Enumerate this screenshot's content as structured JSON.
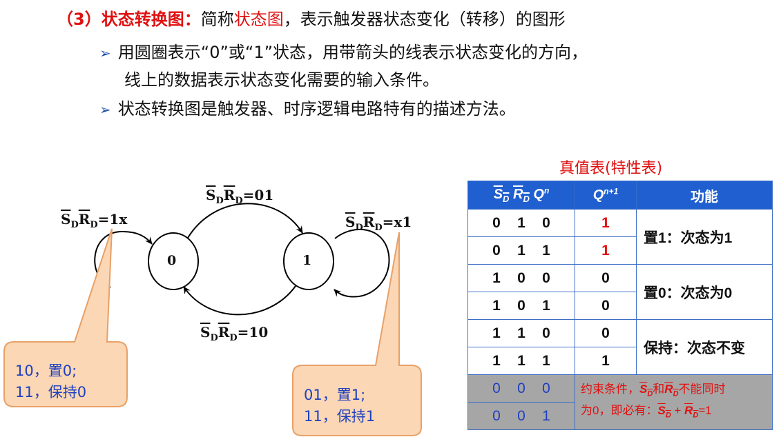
{
  "header": {
    "heading": "（3）状态转换图：",
    "intro_a": "简称",
    "intro_red": "状态图",
    "intro_b": "，表示触发器状态变化（转移）的图形"
  },
  "bullets": {
    "b1_line1": "用圆圈表示“0”或“1”状态，用带箭头的线表示状态变化的方向，",
    "b1_line2": "线上的数据表示状态变化需要的输入条件。",
    "b2": "状态转换图是触发器、时序逻辑电路特有的描述方法。"
  },
  "diagram": {
    "state0": "0",
    "state1": "1",
    "top_label_value": "=01",
    "bottom_label_value": "=10",
    "left_label_value": "=1x",
    "right_label_value": "=x1",
    "callout_left": [
      "10，置0;",
      "11，保持0"
    ],
    "callout_right": [
      "01，置1;",
      "11，保持1"
    ]
  },
  "truth_table": {
    "title": "真值表(特性表)",
    "headers": [
      "S_D R_D Q^n",
      "Q^{n+1}",
      "功能"
    ],
    "rows": [
      {
        "inputs": [
          "0",
          "1",
          "0"
        ],
        "q": "1",
        "func": "置1：次态为1"
      },
      {
        "inputs": [
          "0",
          "1",
          "1"
        ],
        "q": "1"
      },
      {
        "inputs": [
          "1",
          "0",
          "0"
        ],
        "q": "0",
        "func": "置0：次态为0"
      },
      {
        "inputs": [
          "1",
          "0",
          "1"
        ],
        "q": "0"
      },
      {
        "inputs": [
          "1",
          "1",
          "0"
        ],
        "q": "0",
        "func": "保持：次态不变"
      },
      {
        "inputs": [
          "1",
          "1",
          "1"
        ],
        "q": "1"
      },
      {
        "inputs": [
          "0",
          "0",
          "0"
        ],
        "note_a": "约束条件，",
        "note_b": "和",
        "note_c": "不能同时",
        "note_d": "为0，即必有：",
        "note_e": "=1"
      },
      {
        "inputs": [
          "0",
          "0",
          "1"
        ]
      }
    ]
  },
  "colors": {
    "accent_red": "#e01010",
    "table_blue": "#1f5fd0",
    "callout_fill": "#fbd7b5",
    "callout_border": "#e8a068",
    "callout_text": "#1f3fc0"
  }
}
